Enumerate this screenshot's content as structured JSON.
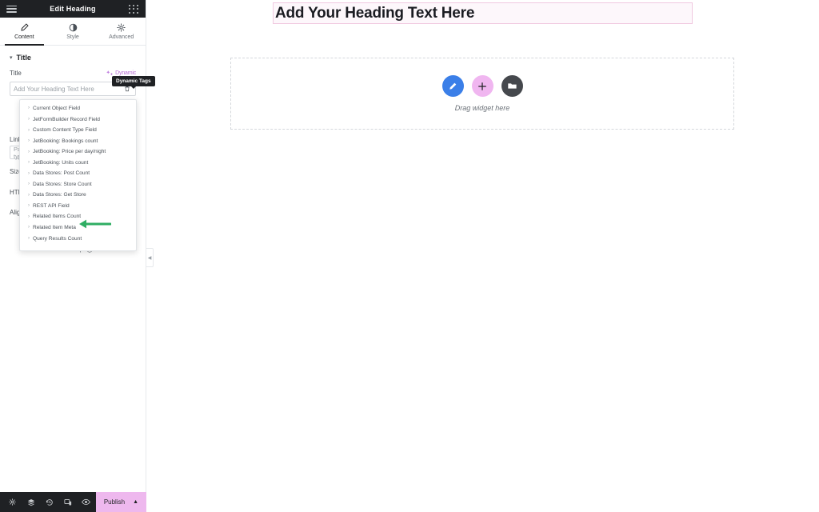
{
  "panel": {
    "header": {
      "title": "Edit Heading",
      "menu_icon": "hamburger-menu-icon",
      "widgets_icon": "widgets-grid-icon"
    },
    "tabs": [
      {
        "label": "Content",
        "icon": "pencil-icon",
        "active": true
      },
      {
        "label": "Style",
        "icon": "contrast-circle-icon",
        "active": false
      },
      {
        "label": "Advanced",
        "icon": "gear-icon",
        "active": false
      }
    ],
    "section": {
      "title": "Title",
      "caret": "▾"
    },
    "title_control": {
      "label": "Title",
      "dynamic_label": "Dynamic",
      "dynamic_icon": "dynamic-tags-icon",
      "tooltip": "Dynamic Tags",
      "input_placeholder": "Add Your Heading Text Here",
      "input_value": "",
      "delete_icon": "trash-icon"
    },
    "other_controls": [
      {
        "label": "Link"
      },
      {
        "label": "Paste URL or type"
      },
      {
        "label": "Size"
      },
      {
        "label": "HTML Tag"
      },
      {
        "label": "Alignment"
      }
    ],
    "dropdown": {
      "items": [
        "Current Object Field",
        "JetFormBuilder Record Field",
        "Custom Content Type Field",
        "JetBooking: Bookings count",
        "JetBooking: Price per day/night",
        "JetBooking: Units count",
        "Data Stores: Post Count",
        "Data Stores: Store Count",
        "Data Stores: Get Store",
        "REST API Field",
        "Related Items Count",
        "Related Item Meta",
        "Query Results Count"
      ]
    },
    "need_help": {
      "label": "Need Help",
      "icon": "question-circle-icon"
    },
    "collapse": {
      "icon": "chevron-left-icon"
    },
    "bottom_bar": {
      "icons": [
        "settings-gear-icon",
        "navigator-layers-icon",
        "history-clock-icon",
        "responsive-mode-icon",
        "preview-eye-icon"
      ],
      "publish_label": "Publish",
      "publish_chevron": "chevron-up-icon"
    }
  },
  "canvas": {
    "heading": {
      "text": "Add Your Heading Text Here"
    },
    "dropzone": {
      "label": "Drag widget here",
      "buttons": [
        {
          "name": "edit-pencil-button",
          "color": "#3b7fe8"
        },
        {
          "name": "add-widget-button",
          "color": "#f0b6f0"
        },
        {
          "name": "templates-folder-button",
          "color": "#45484d"
        }
      ]
    }
  },
  "annotation": {
    "arrow": "green-left-arrow",
    "color": "#2fae63"
  }
}
